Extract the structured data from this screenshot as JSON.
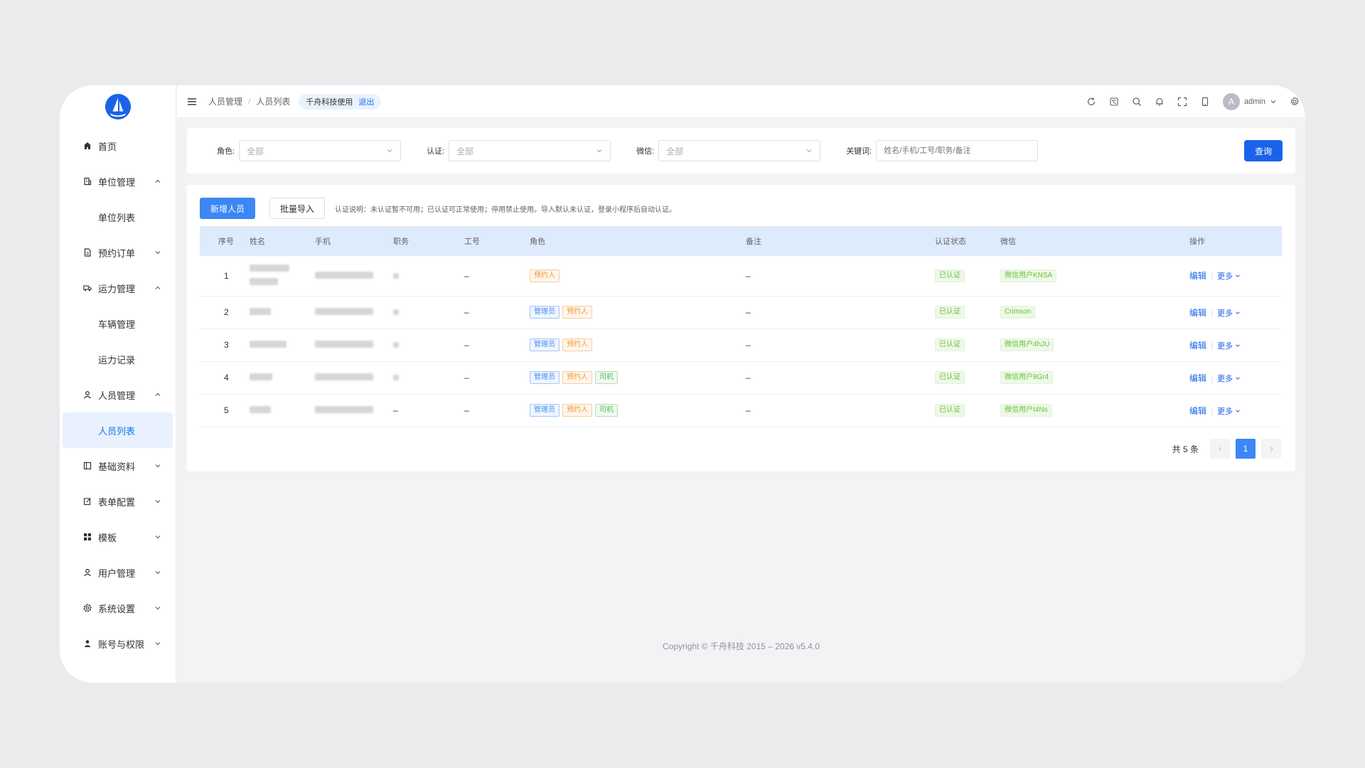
{
  "sidebar": {
    "items": [
      {
        "label": "首页",
        "icon": "home-icon"
      },
      {
        "label": "单位管理",
        "icon": "building-icon",
        "expanded": true
      },
      {
        "label": "单位列表",
        "sub": true
      },
      {
        "label": "预约订单",
        "icon": "document-icon",
        "expanded": false
      },
      {
        "label": "运力管理",
        "icon": "truck-icon",
        "expanded": true
      },
      {
        "label": "车辆管理",
        "sub": true
      },
      {
        "label": "运力记录",
        "sub": true
      },
      {
        "label": "人员管理",
        "icon": "user-icon",
        "expanded": true
      },
      {
        "label": "人员列表",
        "sub": true,
        "active": true
      },
      {
        "label": "基础资料",
        "icon": "book-icon",
        "expanded": false
      },
      {
        "label": "表单配置",
        "icon": "edit-icon",
        "expanded": false
      },
      {
        "label": "模板",
        "icon": "grid-icon",
        "expanded": false
      },
      {
        "label": "用户管理",
        "icon": "user-icon",
        "expanded": false
      },
      {
        "label": "系统设置",
        "icon": "gear-icon",
        "expanded": false
      },
      {
        "label": "账号与权限",
        "icon": "person-icon",
        "expanded": false
      }
    ]
  },
  "header": {
    "breadcrumb": [
      "人员管理",
      "人员列表"
    ],
    "tenant": "千舟科技使用",
    "logout": "退出",
    "user": "admin",
    "avatar_letter": "A"
  },
  "filters": {
    "role_label": "角色:",
    "role_value": "全部",
    "auth_label": "认证:",
    "auth_value": "全部",
    "wechat_label": "微信:",
    "wechat_value": "全部",
    "keyword_label": "关键词:",
    "keyword_placeholder": "姓名/手机/工号/职务/备注",
    "query_button": "查询"
  },
  "toolbar": {
    "add_button": "新增人员",
    "import_button": "批量导入",
    "note": "认证说明：未认证暂不可用；已认证可正常使用；停用禁止使用。导入默认未认证，登录小程序后自动认证。"
  },
  "table": {
    "columns": [
      "序号",
      "姓名",
      "手机",
      "职务",
      "工号",
      "角色",
      "备注",
      "认证状态",
      "微信",
      "操作"
    ],
    "rows": [
      {
        "index": "1",
        "job": "",
        "empno": "–",
        "roles": [
          "预约人"
        ],
        "remark": "–",
        "status": "已认证",
        "wechat": "微信用户KNSA"
      },
      {
        "index": "2",
        "job": "",
        "empno": "–",
        "roles": [
          "管理员",
          "预约人"
        ],
        "remark": "–",
        "status": "已认证",
        "wechat": "Crimson"
      },
      {
        "index": "3",
        "job": "",
        "empno": "–",
        "roles": [
          "管理员",
          "预约人"
        ],
        "remark": "–",
        "status": "已认证",
        "wechat": "微信用户4hJU"
      },
      {
        "index": "4",
        "job": "",
        "empno": "–",
        "roles": [
          "管理员",
          "预约人",
          "司机"
        ],
        "remark": "–",
        "status": "已认证",
        "wechat": "微信用户8Gr4"
      },
      {
        "index": "5",
        "job": "–",
        "empno": "–",
        "roles": [
          "管理员",
          "预约人",
          "司机"
        ],
        "remark": "–",
        "status": "已认证",
        "wechat": "微信用户t4Ns"
      }
    ],
    "edit_label": "编辑",
    "more_label": "更多"
  },
  "pagination": {
    "total": "共 5 条",
    "current": "1"
  },
  "footer": {
    "copyright": "Copyright © 千舟科技 2015 – 2026 v5.4.0"
  },
  "colors": {
    "primary": "#1a63e8",
    "active_bg": "#e8f1fd",
    "table_header_bg": "#deebfd",
    "status_green": "#67c23a",
    "tag_orange": "#f0983a"
  }
}
